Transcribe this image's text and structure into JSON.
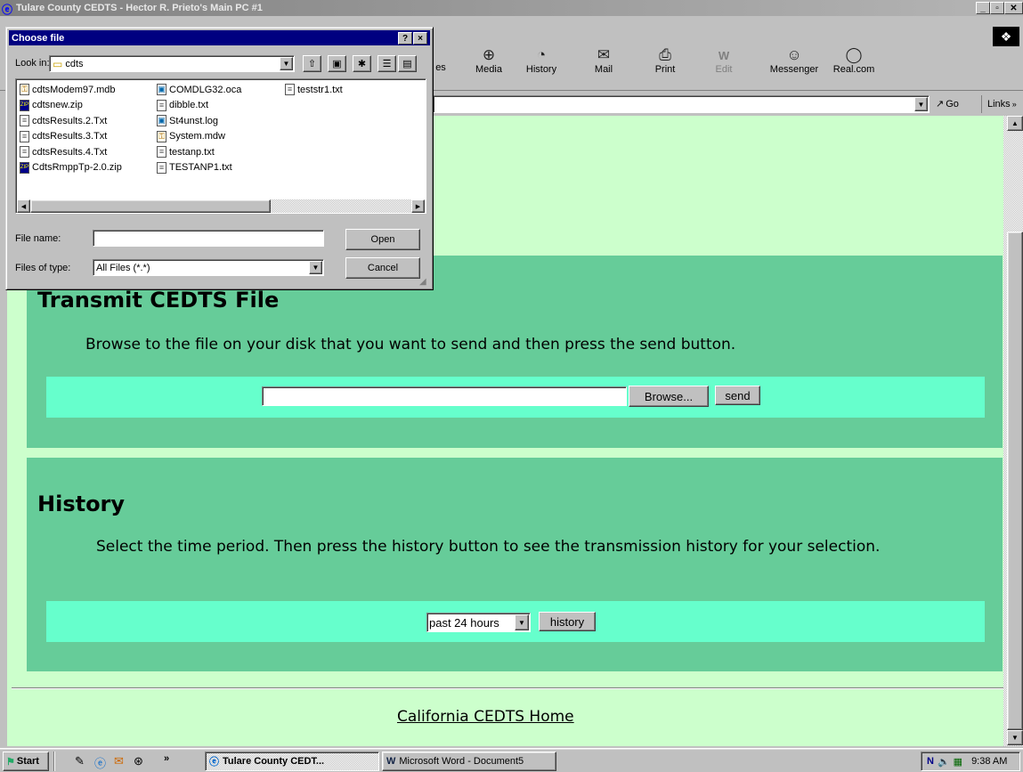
{
  "window": {
    "title": "Tulare County CEDTS - Hector R. Prieto's Main PC #1"
  },
  "toolbar": {
    "buttons": [
      {
        "label": "es",
        "icon": "favorites-icon"
      },
      {
        "label": "Media",
        "icon": "media-icon"
      },
      {
        "label": "History",
        "icon": "history-icon"
      },
      {
        "label": "Mail",
        "icon": "mail-icon"
      },
      {
        "label": "Print",
        "icon": "print-icon"
      },
      {
        "label": "Edit",
        "icon": "edit-icon"
      },
      {
        "label": "Messenger",
        "icon": "messenger-icon"
      },
      {
        "label": "Real.com",
        "icon": "real-icon"
      }
    ],
    "go": "Go",
    "links": "Links"
  },
  "dialog": {
    "title": "Choose file",
    "look_in_label": "Look in:",
    "look_in_value": "cdts",
    "files": [
      {
        "name": "cdtsModem97.mdb",
        "type": "mdb"
      },
      {
        "name": "cdtsnew.zip",
        "type": "zip"
      },
      {
        "name": "cdtsResults.2.Txt",
        "type": "txt"
      },
      {
        "name": "cdtsResults.3.Txt",
        "type": "txt"
      },
      {
        "name": "cdtsResults.4.Txt",
        "type": "txt"
      },
      {
        "name": "CdtsRmppTp-2.0.zip",
        "type": "zip"
      },
      {
        "name": "COMDLG32.oca",
        "type": "oca"
      },
      {
        "name": "dibble.txt",
        "type": "txt"
      },
      {
        "name": "St4unst.log",
        "type": "log"
      },
      {
        "name": "System.mdw",
        "type": "mdw"
      },
      {
        "name": "testanp.txt",
        "type": "txt"
      },
      {
        "name": "TESTANP1.txt",
        "type": "txt"
      },
      {
        "name": "teststr1.txt",
        "type": "txt"
      }
    ],
    "file_name_label": "File name:",
    "file_name_value": "",
    "files_of_type_label": "Files of type:",
    "files_of_type_value": "All Files (*.*)",
    "open_label": "Open",
    "cancel_label": "Cancel",
    "help": "?",
    "close": "×"
  },
  "page": {
    "transmit": {
      "heading": "Transmit CEDTS File",
      "text": "Browse to the file on your disk that you want to send and then press the send button.",
      "browse": "Browse...",
      "send": "send",
      "file_value": ""
    },
    "history": {
      "heading": "History",
      "text": "Select the time period. Then press the history button to see the transmission history for your selection.",
      "period": "past 24 hours",
      "button": "history"
    },
    "footer_link": "California CEDTS Home"
  },
  "taskbar": {
    "start": "Start",
    "tasks": [
      {
        "label": "Tulare County CEDT...",
        "active": true
      },
      {
        "label": "Microsoft Word - Document5",
        "active": false
      }
    ],
    "chevron": "»",
    "clock": "9:38 AM"
  },
  "colors": {
    "page_bg": "#ccffcc",
    "section_bg": "#66cc99",
    "inner_bg": "#66ffcc",
    "dialog_title": "#000080"
  }
}
